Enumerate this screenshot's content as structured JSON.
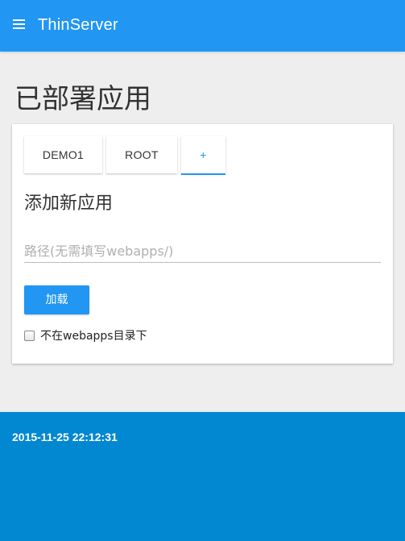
{
  "appbar": {
    "menu_icon": "hamburger-menu-icon",
    "title": "ThinServer",
    "color": "#2196f3"
  },
  "page": {
    "title": "已部署应用"
  },
  "tabs": [
    {
      "label": "DEMO1",
      "active": false
    },
    {
      "label": "ROOT",
      "active": false
    },
    {
      "label": "+",
      "active": true
    }
  ],
  "form": {
    "section_title": "添加新应用",
    "path_placeholder": "路径(无需填写webapps/)",
    "path_value": "",
    "load_button_label": "加载",
    "checkbox_label": "不在webapps目录下",
    "checkbox_checked": false
  },
  "footer": {
    "timestamp": "2015-11-25 22:12:31",
    "color": "#0288d1"
  }
}
